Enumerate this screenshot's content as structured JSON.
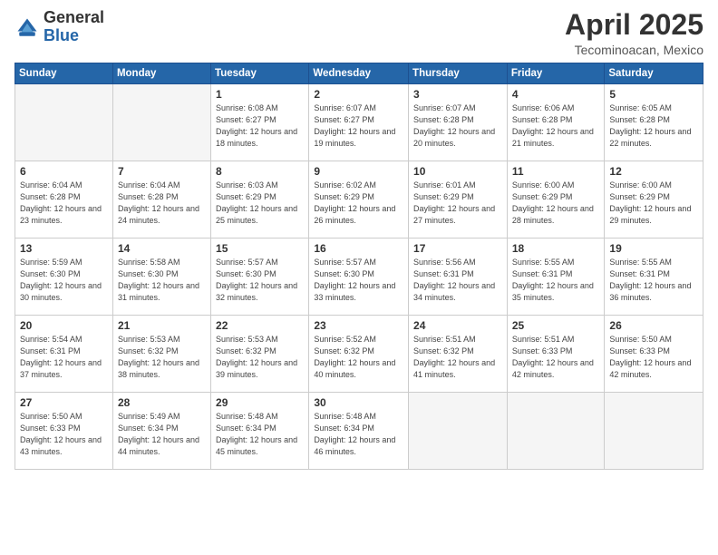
{
  "header": {
    "logo_general": "General",
    "logo_blue": "Blue",
    "month_year": "April 2025",
    "location": "Tecominoacan, Mexico"
  },
  "days_of_week": [
    "Sunday",
    "Monday",
    "Tuesday",
    "Wednesday",
    "Thursday",
    "Friday",
    "Saturday"
  ],
  "weeks": [
    [
      {
        "num": "",
        "empty": true
      },
      {
        "num": "",
        "empty": true
      },
      {
        "num": "1",
        "sunrise": "Sunrise: 6:08 AM",
        "sunset": "Sunset: 6:27 PM",
        "daylight": "Daylight: 12 hours and 18 minutes."
      },
      {
        "num": "2",
        "sunrise": "Sunrise: 6:07 AM",
        "sunset": "Sunset: 6:27 PM",
        "daylight": "Daylight: 12 hours and 19 minutes."
      },
      {
        "num": "3",
        "sunrise": "Sunrise: 6:07 AM",
        "sunset": "Sunset: 6:28 PM",
        "daylight": "Daylight: 12 hours and 20 minutes."
      },
      {
        "num": "4",
        "sunrise": "Sunrise: 6:06 AM",
        "sunset": "Sunset: 6:28 PM",
        "daylight": "Daylight: 12 hours and 21 minutes."
      },
      {
        "num": "5",
        "sunrise": "Sunrise: 6:05 AM",
        "sunset": "Sunset: 6:28 PM",
        "daylight": "Daylight: 12 hours and 22 minutes."
      }
    ],
    [
      {
        "num": "6",
        "sunrise": "Sunrise: 6:04 AM",
        "sunset": "Sunset: 6:28 PM",
        "daylight": "Daylight: 12 hours and 23 minutes."
      },
      {
        "num": "7",
        "sunrise": "Sunrise: 6:04 AM",
        "sunset": "Sunset: 6:28 PM",
        "daylight": "Daylight: 12 hours and 24 minutes."
      },
      {
        "num": "8",
        "sunrise": "Sunrise: 6:03 AM",
        "sunset": "Sunset: 6:29 PM",
        "daylight": "Daylight: 12 hours and 25 minutes."
      },
      {
        "num": "9",
        "sunrise": "Sunrise: 6:02 AM",
        "sunset": "Sunset: 6:29 PM",
        "daylight": "Daylight: 12 hours and 26 minutes."
      },
      {
        "num": "10",
        "sunrise": "Sunrise: 6:01 AM",
        "sunset": "Sunset: 6:29 PM",
        "daylight": "Daylight: 12 hours and 27 minutes."
      },
      {
        "num": "11",
        "sunrise": "Sunrise: 6:00 AM",
        "sunset": "Sunset: 6:29 PM",
        "daylight": "Daylight: 12 hours and 28 minutes."
      },
      {
        "num": "12",
        "sunrise": "Sunrise: 6:00 AM",
        "sunset": "Sunset: 6:29 PM",
        "daylight": "Daylight: 12 hours and 29 minutes."
      }
    ],
    [
      {
        "num": "13",
        "sunrise": "Sunrise: 5:59 AM",
        "sunset": "Sunset: 6:30 PM",
        "daylight": "Daylight: 12 hours and 30 minutes."
      },
      {
        "num": "14",
        "sunrise": "Sunrise: 5:58 AM",
        "sunset": "Sunset: 6:30 PM",
        "daylight": "Daylight: 12 hours and 31 minutes."
      },
      {
        "num": "15",
        "sunrise": "Sunrise: 5:57 AM",
        "sunset": "Sunset: 6:30 PM",
        "daylight": "Daylight: 12 hours and 32 minutes."
      },
      {
        "num": "16",
        "sunrise": "Sunrise: 5:57 AM",
        "sunset": "Sunset: 6:30 PM",
        "daylight": "Daylight: 12 hours and 33 minutes."
      },
      {
        "num": "17",
        "sunrise": "Sunrise: 5:56 AM",
        "sunset": "Sunset: 6:31 PM",
        "daylight": "Daylight: 12 hours and 34 minutes."
      },
      {
        "num": "18",
        "sunrise": "Sunrise: 5:55 AM",
        "sunset": "Sunset: 6:31 PM",
        "daylight": "Daylight: 12 hours and 35 minutes."
      },
      {
        "num": "19",
        "sunrise": "Sunrise: 5:55 AM",
        "sunset": "Sunset: 6:31 PM",
        "daylight": "Daylight: 12 hours and 36 minutes."
      }
    ],
    [
      {
        "num": "20",
        "sunrise": "Sunrise: 5:54 AM",
        "sunset": "Sunset: 6:31 PM",
        "daylight": "Daylight: 12 hours and 37 minutes."
      },
      {
        "num": "21",
        "sunrise": "Sunrise: 5:53 AM",
        "sunset": "Sunset: 6:32 PM",
        "daylight": "Daylight: 12 hours and 38 minutes."
      },
      {
        "num": "22",
        "sunrise": "Sunrise: 5:53 AM",
        "sunset": "Sunset: 6:32 PM",
        "daylight": "Daylight: 12 hours and 39 minutes."
      },
      {
        "num": "23",
        "sunrise": "Sunrise: 5:52 AM",
        "sunset": "Sunset: 6:32 PM",
        "daylight": "Daylight: 12 hours and 40 minutes."
      },
      {
        "num": "24",
        "sunrise": "Sunrise: 5:51 AM",
        "sunset": "Sunset: 6:32 PM",
        "daylight": "Daylight: 12 hours and 41 minutes."
      },
      {
        "num": "25",
        "sunrise": "Sunrise: 5:51 AM",
        "sunset": "Sunset: 6:33 PM",
        "daylight": "Daylight: 12 hours and 42 minutes."
      },
      {
        "num": "26",
        "sunrise": "Sunrise: 5:50 AM",
        "sunset": "Sunset: 6:33 PM",
        "daylight": "Daylight: 12 hours and 42 minutes."
      }
    ],
    [
      {
        "num": "27",
        "sunrise": "Sunrise: 5:50 AM",
        "sunset": "Sunset: 6:33 PM",
        "daylight": "Daylight: 12 hours and 43 minutes."
      },
      {
        "num": "28",
        "sunrise": "Sunrise: 5:49 AM",
        "sunset": "Sunset: 6:34 PM",
        "daylight": "Daylight: 12 hours and 44 minutes."
      },
      {
        "num": "29",
        "sunrise": "Sunrise: 5:48 AM",
        "sunset": "Sunset: 6:34 PM",
        "daylight": "Daylight: 12 hours and 45 minutes."
      },
      {
        "num": "30",
        "sunrise": "Sunrise: 5:48 AM",
        "sunset": "Sunset: 6:34 PM",
        "daylight": "Daylight: 12 hours and 46 minutes."
      },
      {
        "num": "",
        "empty": true
      },
      {
        "num": "",
        "empty": true
      },
      {
        "num": "",
        "empty": true
      }
    ]
  ]
}
